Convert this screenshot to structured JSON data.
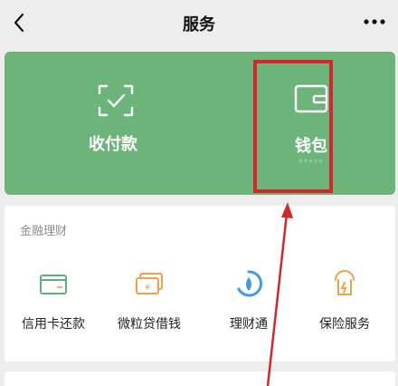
{
  "header": {
    "title": "服务",
    "back_icon": "chevron-left-icon",
    "more_icon": "more-dots-icon"
  },
  "hero": {
    "background": "#6db47a",
    "pay": {
      "label": "收付款",
      "icon": "scan-check-icon"
    },
    "wallet": {
      "label": "钱包",
      "icon": "wallet-icon",
      "masked_balance": "*****"
    }
  },
  "annotation": {
    "color": "#d3272b"
  },
  "finance": {
    "section_title": "金融理财",
    "items": [
      {
        "label": "信用卡还款",
        "icon": "credit-card-icon"
      },
      {
        "label": "微粒贷借钱",
        "icon": "loan-icon"
      },
      {
        "label": "理财通",
        "icon": "wealth-icon"
      },
      {
        "label": "保险服务",
        "icon": "insurance-icon"
      }
    ]
  }
}
